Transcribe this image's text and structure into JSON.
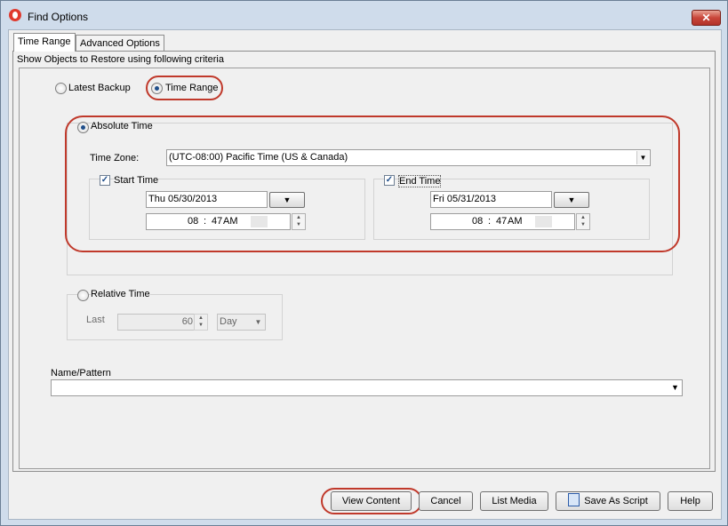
{
  "window": {
    "title": "Find Options",
    "close_symbol": "✕"
  },
  "tabs": [
    {
      "label": "Time Range",
      "selected": true
    },
    {
      "label": "Advanced Options",
      "selected": false
    }
  ],
  "criteria_label": "Show Objects to Restore using following criteria",
  "mode": {
    "latest_backup": {
      "label": "Latest Backup",
      "checked": false
    },
    "time_range": {
      "label": "Time Range",
      "checked": true
    }
  },
  "absolute_time": {
    "label": "Absolute Time",
    "checked": true,
    "time_zone_label": "Time Zone:",
    "time_zone_value": "(UTC-08:00) Pacific Time (US & Canada)",
    "start": {
      "label": "Start Time",
      "checked": true,
      "date": "Thu 05/30/2013",
      "time_hour": "08",
      "time_sep": ":",
      "time_min": "47",
      "time_ampm": "AM"
    },
    "end": {
      "label": "End Time",
      "checked": true,
      "date": "Fri 05/31/2013",
      "time_hour": "08",
      "time_sep": ":",
      "time_min": "47",
      "time_ampm": "AM"
    }
  },
  "relative_time": {
    "label": "Relative Time",
    "checked": false,
    "last_label": "Last",
    "last_value": "60",
    "unit": "Day"
  },
  "name_pattern": {
    "label": "Name/Pattern",
    "value": ""
  },
  "buttons": {
    "view_content": "View Content",
    "cancel": "Cancel",
    "list_media": "List Media",
    "save_as_script": "Save As Script",
    "help": "Help"
  },
  "icons": {
    "app": "app-logo-icon",
    "dropdown": "chevron-down-icon",
    "script": "script-icon"
  },
  "colors": {
    "highlight_oval": "#c0392b",
    "title_bg": "#cfdceb"
  }
}
